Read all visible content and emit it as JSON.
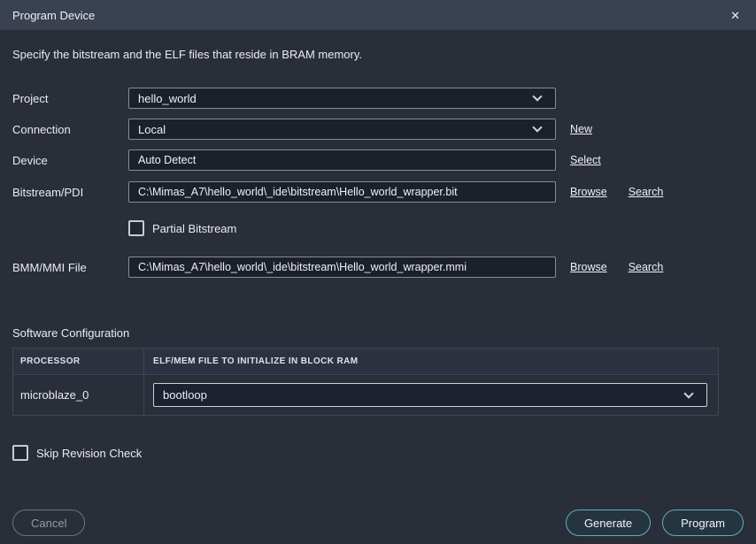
{
  "titlebar": {
    "title": "Program Device",
    "close_glyph": "✕"
  },
  "intro": "Specify the bitstream and the ELF files that reside in BRAM memory.",
  "rows": {
    "project": {
      "label": "Project",
      "value": "hello_world"
    },
    "connection": {
      "label": "Connection",
      "value": "Local",
      "link": "New"
    },
    "device": {
      "label": "Device",
      "value": "Auto Detect",
      "link": "Select"
    },
    "bitstream": {
      "label": "Bitstream/PDI",
      "value": "C:\\Mimas_A7\\hello_world\\_ide\\bitstream\\Hello_world_wrapper.bit",
      "link1": "Browse",
      "link2": "Search"
    },
    "partial": {
      "label": "Partial Bitstream",
      "checked": false
    },
    "bmm": {
      "label": "BMM/MMI File",
      "value": "C:\\Mimas_A7\\hello_world\\_ide\\bitstream\\Hello_world_wrapper.mmi",
      "link1": "Browse",
      "link2": "Search"
    }
  },
  "software": {
    "heading": "Software Configuration",
    "col_processor": "PROCESSOR",
    "col_elf": "ELF/MEM FILE TO INITIALIZE IN BLOCK RAM",
    "row_processor": "microblaze_0",
    "row_elf_value": "bootloop"
  },
  "skip_revision": {
    "label": "Skip Revision Check",
    "checked": false
  },
  "footer": {
    "cancel": "Cancel",
    "generate": "Generate",
    "program": "Program"
  },
  "colors": {
    "titlebar_bg": "#3a4150",
    "body_bg": "#2a2e39",
    "input_bg": "#1c202a",
    "accent_teal": "#5bb0bf"
  }
}
